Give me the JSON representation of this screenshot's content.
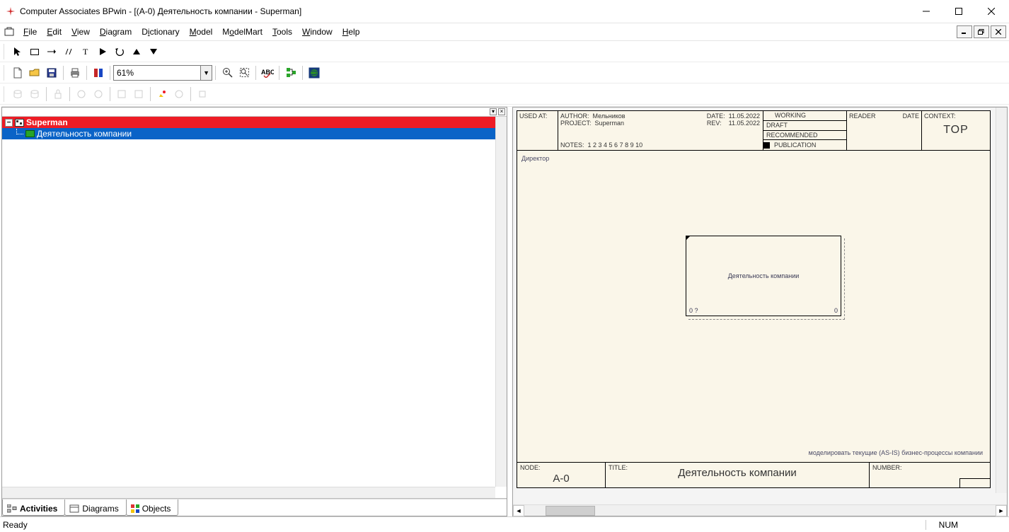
{
  "window": {
    "title": "Computer Associates BPwin - [(A-0) Деятельность компании - Superman]"
  },
  "menu": {
    "file": "File",
    "edit": "Edit",
    "view": "View",
    "diagram": "Diagram",
    "dictionary": "Dictionary",
    "model": "Model",
    "modelmart": "ModelMart",
    "tools": "Tools",
    "window": "Window",
    "help": "Help"
  },
  "zoom": {
    "value": "61%"
  },
  "tree": {
    "root": "Superman",
    "child": "Деятельность компании"
  },
  "tabs": {
    "activities": "Activities",
    "diagrams": "Diagrams",
    "objects": "Objects"
  },
  "idef": {
    "used_at_label": "USED AT:",
    "author_label": "AUTHOR:",
    "author": "Мельников",
    "project_label": "PROJECT:",
    "project": "Superman",
    "date_label": "DATE:",
    "date": "11.05.2022",
    "rev_label": "REV:",
    "rev": "11.05.2022",
    "notes_label": "NOTES:",
    "notes_nums": "1 2 3 4 5 6 7 8 9 10",
    "working": "WORKING",
    "draft": "DRAFT",
    "recommended": "RECOMMENDED",
    "publication": "PUBLICATION",
    "reader": "READER",
    "date2": "DATE",
    "context": "CONTEXT:",
    "context_value": "TOP",
    "director": "Директор",
    "activity": "Деятельность компании",
    "activity_id_left": "0 ?",
    "purpose": "моделировать текущие (AS-IS) бизнес-процессы компании",
    "node_label": "NODE:",
    "node": "A-0",
    "title_label": "TITLE:",
    "title_value": "Деятельность компании",
    "number_label": "NUMBER:"
  },
  "status": {
    "ready": "Ready",
    "num": "NUM"
  }
}
